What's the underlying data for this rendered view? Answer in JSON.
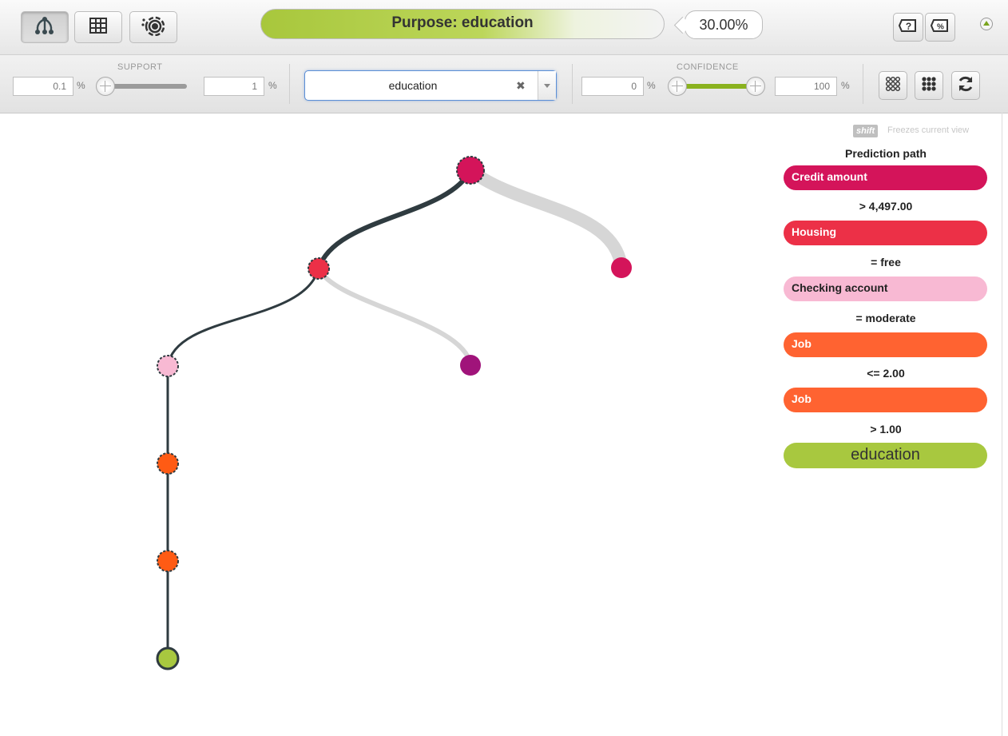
{
  "header": {
    "view_buttons": [
      {
        "name": "tree-view-icon"
      },
      {
        "name": "table-view-icon"
      },
      {
        "name": "sunburst-view-icon"
      }
    ],
    "purpose_label": "Purpose: education",
    "percentage": "30.00%",
    "summary_buttons": [
      {
        "name": "question-summary-icon"
      },
      {
        "name": "percent-summary-icon"
      }
    ],
    "collapse_icon": "collapse-up-icon"
  },
  "filters": {
    "support": {
      "label": "SUPPORT",
      "min": "0.1",
      "max": "1",
      "unit": "%",
      "range": [
        0.001,
        0.01
      ]
    },
    "output_select": {
      "value": "education",
      "clear": "✖"
    },
    "confidence": {
      "label": "CONFIDENCE",
      "min": "0",
      "max": "100",
      "unit": "%",
      "range": [
        0,
        1
      ]
    },
    "action_buttons": [
      {
        "name": "sparse-grid-icon"
      },
      {
        "name": "dense-grid-icon"
      },
      {
        "name": "refresh-icon"
      }
    ]
  },
  "sidebar": {
    "shift_key": "shift",
    "shift_hint": "Freezes current view",
    "title": "Prediction path",
    "path": [
      {
        "field": "Credit amount",
        "condition": "> 4,497.00",
        "color": "#d4145a"
      },
      {
        "field": "Housing",
        "condition": "= free",
        "color": "#ec3047"
      },
      {
        "field": "Checking account",
        "condition": "= moderate",
        "color": "#f8b9d3"
      },
      {
        "field": "Job",
        "condition": "<= 2.00",
        "color": "#ff6331"
      },
      {
        "field": "Job",
        "condition": "> 1.00",
        "color": "#ff6331"
      }
    ],
    "prediction": "education",
    "prediction_color": "#a8c83f"
  },
  "tree": {
    "nodes": [
      {
        "name": "credit-amount-node",
        "color": "#d4145a",
        "on_path": true
      },
      {
        "name": "housing-node",
        "color": "#ec3047",
        "on_path": true
      },
      {
        "name": "sibling-right-node",
        "color": "#d4145a",
        "on_path": false
      },
      {
        "name": "checking-account-node",
        "color": "#f8b9d3",
        "on_path": true
      },
      {
        "name": "sibling-purple-node",
        "color": "#a0147a",
        "on_path": false
      },
      {
        "name": "job-node-1",
        "color": "#ff5b14",
        "on_path": true
      },
      {
        "name": "job-node-2",
        "color": "#ff5b14",
        "on_path": true
      },
      {
        "name": "leaf-education-node",
        "color": "#a8c83f",
        "on_path": true
      }
    ],
    "path_color": "#2f3b40",
    "inactive_color": "#d6d6d6"
  }
}
